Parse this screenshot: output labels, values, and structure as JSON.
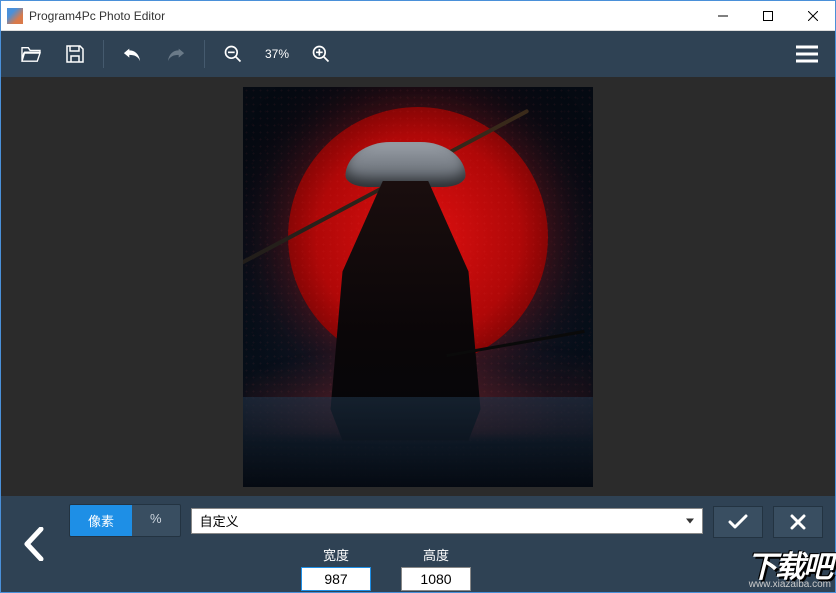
{
  "titlebar": {
    "title": "Program4Pc Photo Editor"
  },
  "toolbar": {
    "zoom_level": "37%"
  },
  "bottom": {
    "unit_pixel": "像素",
    "unit_percent": "%",
    "preset_selected": "自定义",
    "width_label": "宽度",
    "height_label": "高度",
    "width_value": "987",
    "height_value": "1080"
  },
  "watermark": {
    "text_main": "下载吧",
    "text_url": "www.xiazaiba.com"
  }
}
